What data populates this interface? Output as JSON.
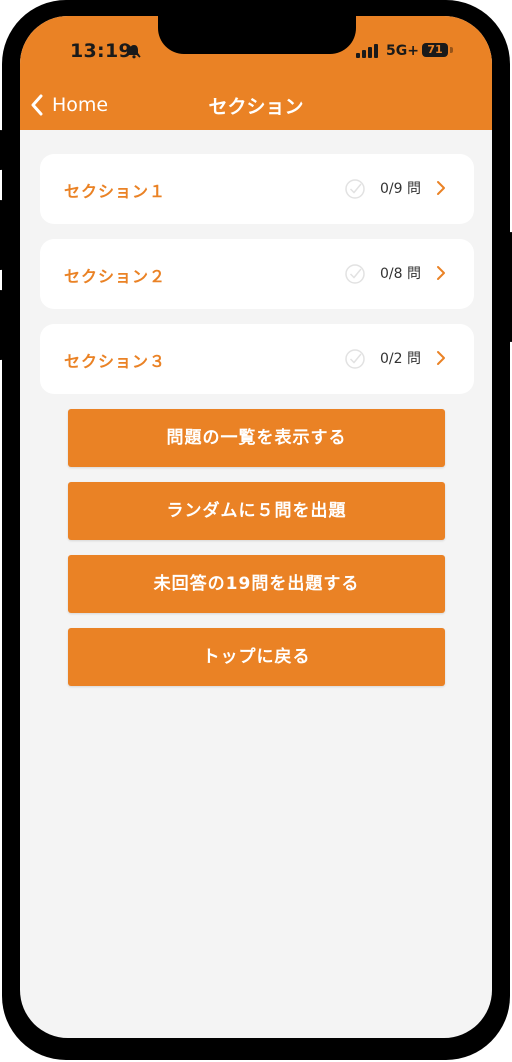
{
  "status_bar": {
    "time": "13:19",
    "network": "5G+",
    "battery": "71"
  },
  "nav": {
    "back_label": "Home",
    "title": "セクション"
  },
  "sections": [
    {
      "name": "セクション１",
      "progress": "0/9 問"
    },
    {
      "name": "セクション２",
      "progress": "0/8 問"
    },
    {
      "name": "セクション３",
      "progress": "0/2 問"
    }
  ],
  "actions": [
    {
      "label": "問題の一覧を表示する"
    },
    {
      "label": "ランダムに５問を出題"
    },
    {
      "label": "未回答の19問を出題する"
    },
    {
      "label": "トップに戻る"
    }
  ],
  "colors": {
    "accent": "#ea8225",
    "background": "#f4f4f4",
    "card": "#ffffff"
  }
}
